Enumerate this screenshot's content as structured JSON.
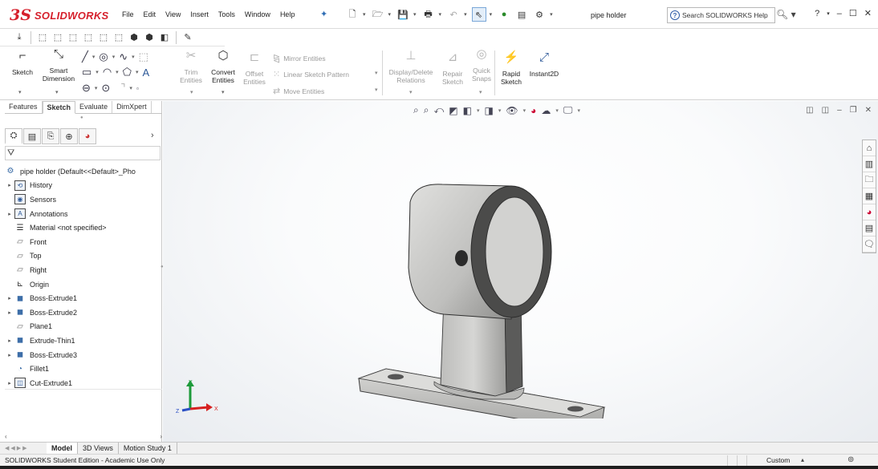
{
  "app": {
    "brand": "SOLIDWORKS",
    "document_title": "pipe holder",
    "menu": [
      "File",
      "Edit",
      "View",
      "Insert",
      "Tools",
      "Window",
      "Help"
    ],
    "search_placeholder": "Search SOLIDWORKS Help"
  },
  "ribbon": {
    "sketch": "Sketch",
    "smart_dimension": "Smart Dimension",
    "trim_entities": "Trim Entities",
    "convert_entities": "Convert Entities",
    "offset_entities": "Offset Entities",
    "mirror_entities": "Mirror Entities",
    "linear_sketch_pattern": "Linear Sketch Pattern",
    "move_entities": "Move Entities",
    "display_delete_relations": "Display/Delete Relations",
    "repair_sketch": "Repair Sketch",
    "quick_snaps": "Quick Snaps",
    "rapid_sketch": "Rapid Sketch",
    "instant2d": "Instant2D"
  },
  "panel": {
    "tabs": [
      "Features",
      "Sketch",
      "Evaluate",
      "DimXpert"
    ],
    "active_tab": "Sketch",
    "tree": {
      "root": "pipe holder  (Default<<Default>_Pho",
      "items": [
        {
          "label": "History",
          "expandable": true,
          "icon": "history-icon"
        },
        {
          "label": "Sensors",
          "expandable": false,
          "icon": "sensors-icon"
        },
        {
          "label": "Annotations",
          "expandable": true,
          "icon": "annotations-icon"
        },
        {
          "label": "Material <not specified>",
          "expandable": false,
          "icon": "material-icon"
        },
        {
          "label": "Front",
          "expandable": false,
          "icon": "plane-icon"
        },
        {
          "label": "Top",
          "expandable": false,
          "icon": "plane-icon"
        },
        {
          "label": "Right",
          "expandable": false,
          "icon": "plane-icon"
        },
        {
          "label": "Origin",
          "expandable": false,
          "icon": "origin-icon"
        },
        {
          "label": "Boss-Extrude1",
          "expandable": true,
          "icon": "extrude-icon"
        },
        {
          "label": "Boss-Extrude2",
          "expandable": true,
          "icon": "extrude-icon"
        },
        {
          "label": "Plane1",
          "expandable": false,
          "icon": "plane-icon"
        },
        {
          "label": "Extrude-Thin1",
          "expandable": true,
          "icon": "extrude-icon"
        },
        {
          "label": "Boss-Extrude3",
          "expandable": true,
          "icon": "extrude-icon"
        },
        {
          "label": "Fillet1",
          "expandable": false,
          "icon": "fillet-icon"
        },
        {
          "label": "Cut-Extrude1",
          "expandable": true,
          "icon": "cut-extrude-icon"
        }
      ]
    }
  },
  "bottom_tabs": [
    "Model",
    "3D Views",
    "Motion Study 1"
  ],
  "active_bottom_tab": "Model",
  "status": {
    "left": "SOLIDWORKS Student Edition - Academic Use Only",
    "units": "Custom"
  },
  "triad": {
    "x": "X",
    "y": "Y",
    "z": "Z"
  },
  "colors": {
    "brand_red": "#d6202c",
    "axis_x": "#d62020",
    "axis_y": "#1d9a3a",
    "axis_z": "#2b4fc4"
  }
}
